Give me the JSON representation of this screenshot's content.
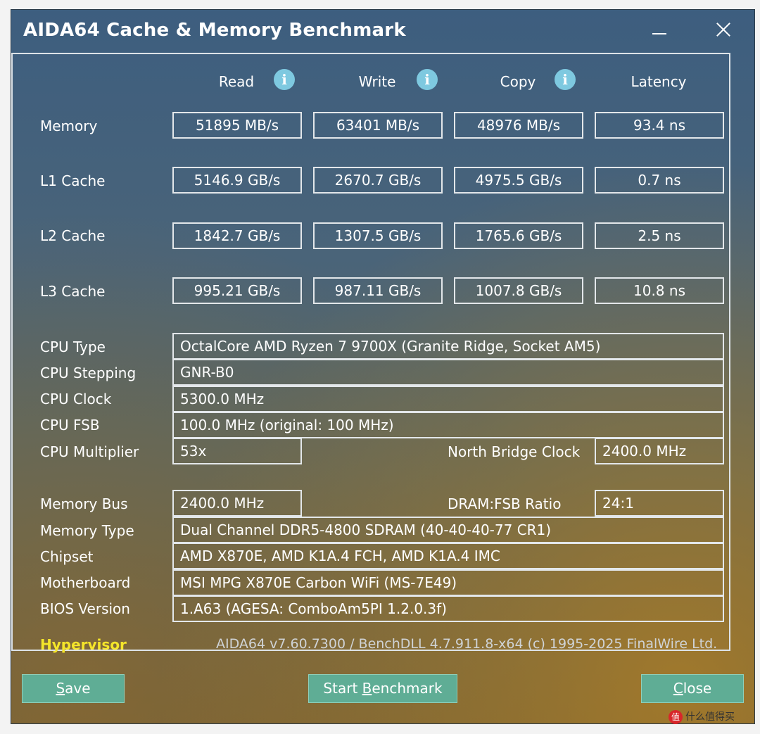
{
  "window": {
    "title": "AIDA64 Cache & Memory Benchmark"
  },
  "columns": {
    "read": "Read",
    "write": "Write",
    "copy": "Copy",
    "latency": "Latency"
  },
  "rows": [
    {
      "label": "Memory",
      "read": "51895 MB/s",
      "write": "63401 MB/s",
      "copy": "48976 MB/s",
      "latency": "93.4 ns"
    },
    {
      "label": "L1 Cache",
      "read": "5146.9 GB/s",
      "write": "2670.7 GB/s",
      "copy": "4975.5 GB/s",
      "latency": "0.7 ns"
    },
    {
      "label": "L2 Cache",
      "read": "1842.7 GB/s",
      "write": "1307.5 GB/s",
      "copy": "1765.6 GB/s",
      "latency": "2.5 ns"
    },
    {
      "label": "L3 Cache",
      "read": "995.21 GB/s",
      "write": "987.11 GB/s",
      "copy": "1007.8 GB/s",
      "latency": "10.8 ns"
    }
  ],
  "info": {
    "cpu_type": {
      "label": "CPU Type",
      "value": "OctalCore AMD Ryzen 7 9700X  (Granite Ridge, Socket AM5)"
    },
    "cpu_stepping": {
      "label": "CPU Stepping",
      "value": "GNR-B0"
    },
    "cpu_clock": {
      "label": "CPU Clock",
      "value": "5300.0 MHz"
    },
    "cpu_fsb": {
      "label": "CPU FSB",
      "value": "100.0 MHz  (original: 100 MHz)"
    },
    "cpu_multiplier": {
      "label": "CPU Multiplier",
      "value": "53x"
    },
    "north_bridge_clock": {
      "label": "North Bridge Clock",
      "value": "2400.0 MHz"
    },
    "memory_bus": {
      "label": "Memory Bus",
      "value": "2400.0 MHz"
    },
    "dram_fsb_ratio": {
      "label": "DRAM:FSB Ratio",
      "value": "24:1"
    },
    "memory_type": {
      "label": "Memory Type",
      "value": "Dual Channel DDR5-4800 SDRAM  (40-40-40-77 CR1)"
    },
    "chipset": {
      "label": "Chipset",
      "value": "AMD X870E, AMD K1A.4 FCH, AMD K1A.4 IMC"
    },
    "motherboard": {
      "label": "Motherboard",
      "value": "MSI MPG X870E Carbon WiFi (MS-7E49)"
    },
    "bios_version": {
      "label": "BIOS Version",
      "value": "1.A63  (AGESA: ComboAm5PI 1.2.0.3f)"
    }
  },
  "status": {
    "hypervisor": "Hypervisor",
    "version": "AIDA64 v7.60.7300 / BenchDLL 4.7.911.8-x64  (c) 1995-2025 FinalWire Ltd."
  },
  "buttons": {
    "save_hotkey": "S",
    "save_rest": "ave",
    "start_pre": "Start ",
    "start_hotkey": "B",
    "start_rest": "enchmark",
    "close_hotkey": "C",
    "close_rest": "lose"
  },
  "watermark": {
    "logo": "值",
    "text": "什么值得买"
  },
  "icons": {
    "info": "info-icon",
    "minimize": "minimize-icon",
    "close": "close-icon"
  },
  "colors": {
    "button": "#5fad95",
    "hypervisor": "#f4e52a",
    "info_icon": "#7ec9e0"
  }
}
